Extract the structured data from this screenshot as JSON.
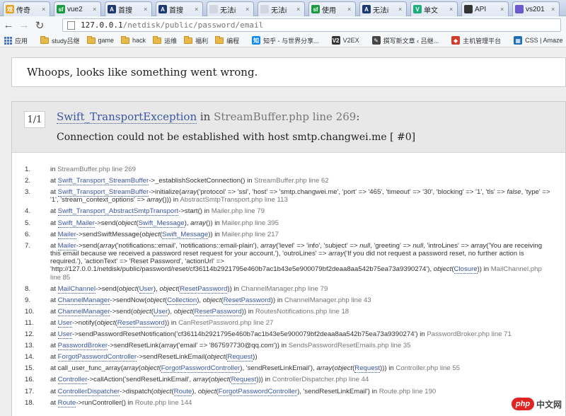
{
  "tabs": [
    {
      "title": "传奇",
      "fav": "戏",
      "color": "#e5a323"
    },
    {
      "title": "vue2",
      "fav": "sf",
      "color": "#1b9a42"
    },
    {
      "title": "首搜",
      "fav": "A",
      "color": "#1e3a6e"
    },
    {
      "title": "首搜",
      "fav": "A",
      "color": "#1e3a6e"
    },
    {
      "title": "无法i",
      "fav": "",
      "color": "#cfd6e0"
    },
    {
      "title": "无法i",
      "fav": "",
      "color": "#cfd6e0"
    },
    {
      "title": "使用",
      "fav": "sf",
      "color": "#1b9a42"
    },
    {
      "title": "无法i",
      "fav": "A",
      "color": "#1e3a6e"
    },
    {
      "title": "单文",
      "fav": "V",
      "color": "#1fae7a"
    },
    {
      "title": "API",
      "fav": "",
      "color": "#333333"
    },
    {
      "title": "vs201",
      "fav": "",
      "color": "#6a5acd"
    }
  ],
  "address": {
    "host": "127.0.0.1",
    "path": "/netdisk/public/password/email"
  },
  "bookmarks": {
    "apps": "应用",
    "items": [
      {
        "label": "study吕继",
        "icon": "folder"
      },
      {
        "label": "game",
        "icon": "folder"
      },
      {
        "label": "hack",
        "icon": "folder"
      },
      {
        "label": "运维",
        "icon": "folder"
      },
      {
        "label": "福利",
        "icon": "folder"
      },
      {
        "label": "编程",
        "icon": "folder"
      },
      {
        "label": "知乎 - 与世界分享...",
        "icon": "知",
        "color": "#0f88eb"
      },
      {
        "label": "V2EX",
        "icon": "V2",
        "color": "#333333"
      },
      {
        "label": "撰写新文章 ‹ 吕继...",
        "icon": "✎",
        "color": "#464646"
      },
      {
        "label": "主机管理平台",
        "icon": "◆",
        "color": "#d33b2f"
      },
      {
        "label": "CSS | Amaze",
        "icon": "▦",
        "color": "#1f6fb2"
      }
    ]
  },
  "whoops": "Whoops, looks like something went wrong.",
  "exception": {
    "counter": "1/1",
    "class": "Swift_TransportException",
    "in_text": " in ",
    "location": "StreamBuffer.php line 269",
    "colon": ":",
    "message": "Connection could not be established with host smtp.changwei.me [ #0]"
  },
  "trace": [
    {
      "n": "1.",
      "html": "in <span class=\"file\">StreamBuffer.php line 269</span>"
    },
    {
      "n": "2.",
      "html": "at <span class=\"ref\">Swift_Transport_StreamBuffer</span>->_establishSocketConnection() in <span class=\"file\">StreamBuffer.php line 62</span>"
    },
    {
      "n": "3.",
      "html": "at <span class=\"ref\">Swift_Transport_StreamBuffer</span>->initialize(<i>array</i>('protocol' => 'ssl', 'host' => 'smtp.changwei.me', 'port' => '465', 'timeout' => '30', 'blocking' => '1', 'tls' => <i>false</i>, 'type' => '1', 'stream_context_options' => <i>array</i>())) in <span class=\"file\">AbstractSmtpTransport.php line 113</span>"
    },
    {
      "n": "4.",
      "html": "at <span class=\"ref\">Swift_Transport_AbstractSmtpTransport</span>->start() in <span class=\"file\">Mailer.php line 79</span>"
    },
    {
      "n": "5.",
      "html": "at <span class=\"ref\">Swift_Mailer</span>->send(<i>object</i>(<span class=\"ref\">Swift_Message</span>), <i>array</i>()) in <span class=\"file\">Mailer.php line 395</span>"
    },
    {
      "n": "6.",
      "html": "at <span class=\"ref\">Mailer</span>->sendSwiftMessage(<i>object</i>(<span class=\"ref\">Swift_Message</span>)) in <span class=\"file\">Mailer.php line 217</span>"
    },
    {
      "n": "7.",
      "html": "at <span class=\"ref\">Mailer</span>->send(<i>array</i>('notifications::email', 'notifications::email-plain'), <i>array</i>('level' => 'info', 'subject' => <i>null</i>, 'greeting' => <i>null</i>, 'introLines' => <i>array</i>('You are receiving this email because we received a password reset request for your account.'), 'outroLines' => <i>array</i>('If you did not request a password reset, no further action is required.'), 'actionText' => 'Reset Password', 'actionUrl' => 'http://127.0.0.1/netdisk/public/password/reset/cf36114b2921795e460b7ac1b43e5e900079bf2deaa8aa542b75ea73a9390274'), <i>object</i>(<span class=\"ref\">Closure</span>)) in <span class=\"file\">MailChannel.php line 85</span>"
    },
    {
      "n": "8.",
      "html": "at <span class=\"ref\">MailChannel</span>->send(<i>object</i>(<span class=\"ref\">User</span>), <i>object</i>(<span class=\"ref\">ResetPassword</span>)) in <span class=\"file\">ChannelManager.php line 79</span>"
    },
    {
      "n": "9.",
      "html": "at <span class=\"ref\">ChannelManager</span>->sendNow(<i>object</i>(<span class=\"ref\">Collection</span>), <i>object</i>(<span class=\"ref\">ResetPassword</span>)) in <span class=\"file\">ChannelManager.php line 43</span>"
    },
    {
      "n": "10.",
      "html": "at <span class=\"ref\">ChannelManager</span>->send(<i>object</i>(<span class=\"ref\">User</span>), <i>object</i>(<span class=\"ref\">ResetPassword</span>)) in <span class=\"file\">RoutesNotifications.php line 18</span>"
    },
    {
      "n": "11.",
      "html": "at <span class=\"ref\">User</span>->notify(<i>object</i>(<span class=\"ref\">ResetPassword</span>)) in <span class=\"file\">CanResetPassword.php line 27</span>"
    },
    {
      "n": "12.",
      "html": "at <span class=\"ref\">User</span>->sendPasswordResetNotification('cf36114b2921795e460b7ac1b43e5e900079bf2deaa8aa542b75ea73a9390274') in <span class=\"file\">PasswordBroker.php line 71</span>"
    },
    {
      "n": "13.",
      "html": "at <span class=\"ref\">PasswordBroker</span>->sendResetLink(<i>array</i>('email' => '867597730@qq.com')) in <span class=\"file\">SendsPasswordResetEmails.php line 35</span>"
    },
    {
      "n": "14.",
      "html": "at <span class=\"ref\">ForgotPasswordController</span>->sendResetLinkEmail(<i>object</i>(<span class=\"ref\">Request</span>))"
    },
    {
      "n": "15.",
      "html": "at call_user_func_array(<i>array</i>(<i>object</i>(<span class=\"ref\">ForgotPasswordController</span>), 'sendResetLinkEmail'), <i>array</i>(<i>object</i>(<span class=\"ref\">Request</span>))) in <span class=\"file\">Controller.php line 55</span>"
    },
    {
      "n": "16.",
      "html": "at <span class=\"ref\">Controller</span>->callAction('sendResetLinkEmail', <i>array</i>(<i>object</i>(<span class=\"ref\">Request</span>))) in <span class=\"file\">ControllerDispatcher.php line 44</span>"
    },
    {
      "n": "17.",
      "html": "at <span class=\"ref\">ControllerDispatcher</span>->dispatch(<i>object</i>(<span class=\"ref\">Route</span>), <i>object</i>(<span class=\"ref\">ForgotPasswordController</span>), 'sendResetLinkEmail') in <span class=\"file\">Route.php line 190</span>"
    },
    {
      "n": "18.",
      "html": "at <span class=\"ref\">Route</span>->runController() in <span class=\"file\">Route.php line 144</span>"
    }
  ],
  "watermark": {
    "logo": "php",
    "text": "中文网"
  }
}
